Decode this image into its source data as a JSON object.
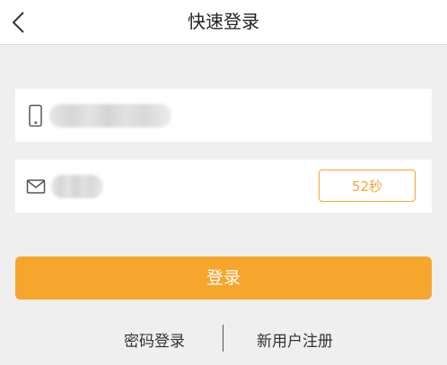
{
  "header": {
    "title": "快速登录"
  },
  "phone_field": {
    "icon": "phone-icon",
    "value": "",
    "placeholder": ""
  },
  "code_field": {
    "icon": "mail-icon",
    "value": "",
    "placeholder": "",
    "countdown_label": "52秒"
  },
  "login_button": {
    "label": "登录"
  },
  "links": {
    "password_login": "密码登录",
    "new_user_register": "新用户注册"
  },
  "colors": {
    "accent": "#f6a62c",
    "background": "#efefef"
  }
}
